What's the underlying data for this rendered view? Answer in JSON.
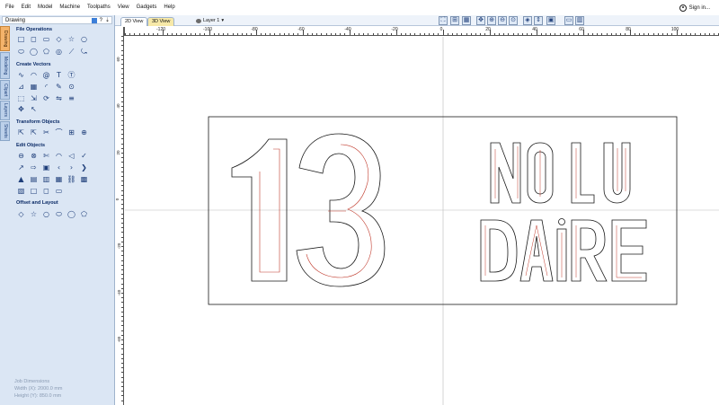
{
  "menubar": {
    "items": [
      "File",
      "Edit",
      "Model",
      "Machine",
      "Toolpaths",
      "View",
      "Gadgets",
      "Help"
    ],
    "signin_label": "Sign in..."
  },
  "panel": {
    "title": "Drawing",
    "header_help": "?",
    "side_tabs": [
      "Drawing",
      "Modeling",
      "Clipart",
      "Layers",
      "Sheets"
    ],
    "sections": {
      "file_operations": "File Operations",
      "create_vectors": "Create Vectors",
      "transform_objects": "Transform Objects",
      "edit_objects": "Edit Objects",
      "offset_layout": "Offset and Layout"
    },
    "job_info": {
      "title": "Job Dimensions",
      "width": "Width (X): 2000.0 mm",
      "height": "Height (Y): 850.0 mm"
    }
  },
  "viewbar": {
    "tab_2d": "2D View",
    "tab_3d": "3D View",
    "layer_label": "Layer 1"
  },
  "ruler": {
    "top_labels": [
      "-120",
      "-100",
      "-80",
      "-60",
      "-40",
      "-20",
      "0",
      "20",
      "40",
      "60",
      "80",
      "100"
    ],
    "left_labels": [
      "60",
      "40",
      "20",
      "0",
      "-20",
      "-40",
      "-60"
    ]
  },
  "canvas": {
    "design_text_left": "13",
    "design_text_right_top": "NOLU",
    "design_text_right_bottom": "DAİRE"
  },
  "colors": {
    "panel_bg": "#dbe6f4",
    "active_tab": "#f4b36b",
    "toolpath_red": "#c0392b",
    "vector_black": "#1a1a1a",
    "accent_blue": "#3c7fd9"
  },
  "icons": [
    "hamburger-icon",
    "user-icon",
    "new-file-icon",
    "open-folder-icon",
    "save-icon",
    "import-icon",
    "undo-icon",
    "redo-icon",
    "circle-icon",
    "ellipse-icon",
    "rectangle-icon",
    "polygon-icon",
    "star-icon",
    "polyline-icon",
    "arc-icon",
    "spline-icon",
    "spiral-icon",
    "text-icon",
    "move-icon",
    "rotate-icon",
    "mirror-icon",
    "align-icon",
    "node-edit-icon",
    "trim-icon",
    "offset-icon",
    "array-icon"
  ]
}
